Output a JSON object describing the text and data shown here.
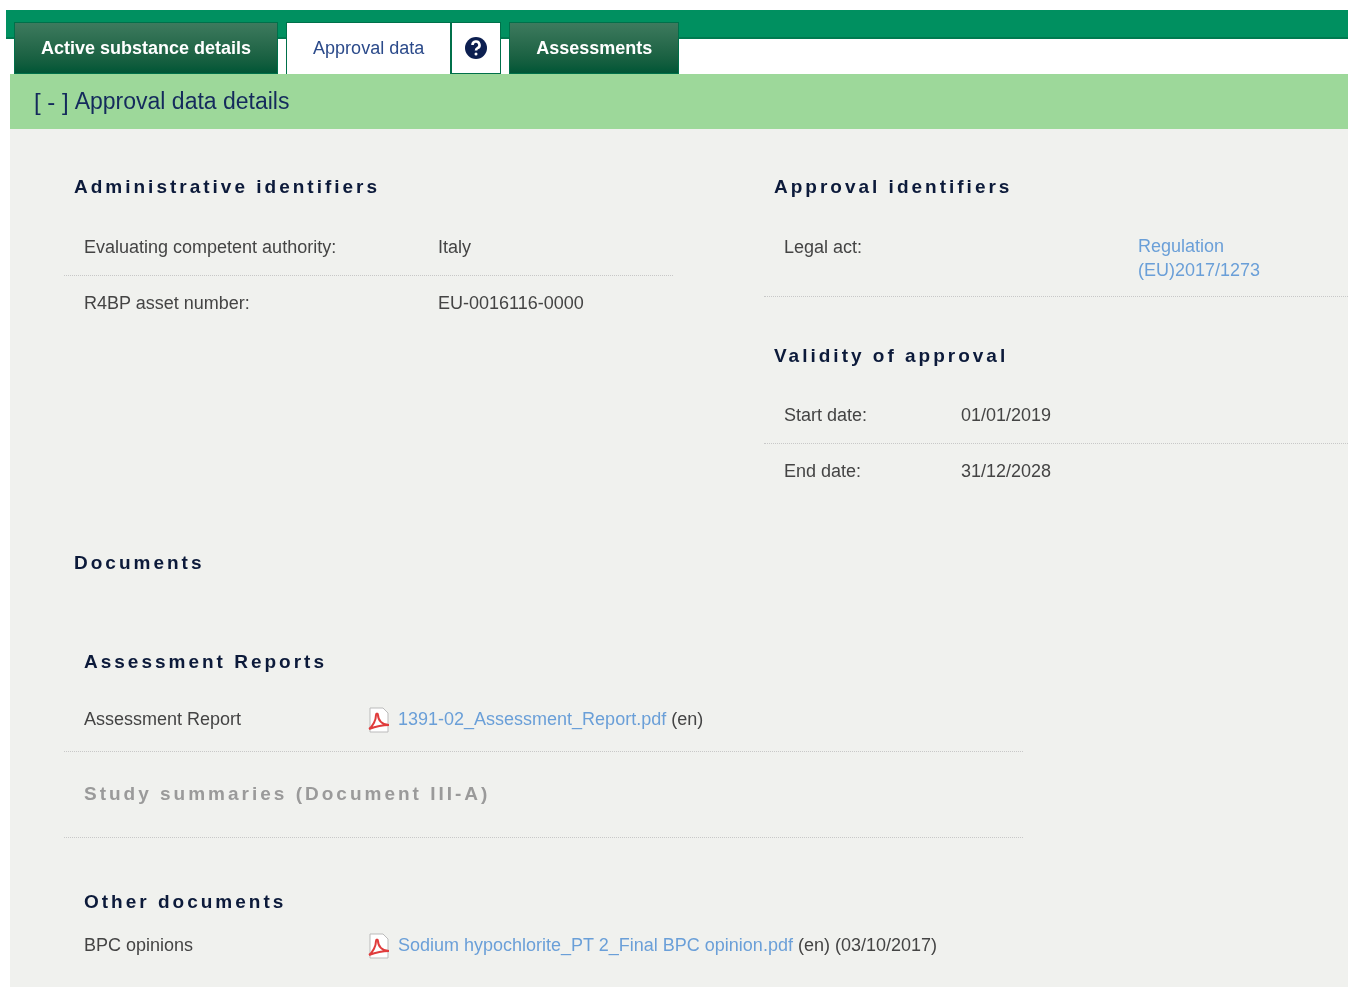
{
  "tabs": [
    {
      "label": "Active substance details",
      "selected": false,
      "has_help": false
    },
    {
      "label": "Approval data",
      "selected": true,
      "has_help": true
    },
    {
      "label": "Assessments",
      "selected": false,
      "has_help": false
    }
  ],
  "section": {
    "toggle": "[ - ]",
    "title": "Approval data details"
  },
  "administrative_identifiers": {
    "heading": "Administrative identifiers",
    "rows": [
      {
        "label": "Evaluating competent authority:",
        "value": "Italy"
      },
      {
        "label": "R4BP asset number:",
        "value": "EU-0016116-0000"
      }
    ]
  },
  "approval_identifiers": {
    "heading": "Approval identifiers",
    "rows": [
      {
        "label": "Legal act:",
        "value": "Regulation (EU)2017/1273",
        "kind": "link"
      }
    ]
  },
  "validity_of_approval": {
    "heading": "Validity of approval",
    "rows": [
      {
        "label": "Start date:",
        "value": "01/01/2019"
      },
      {
        "label": "End date:",
        "value": "31/12/2028"
      }
    ]
  },
  "documents": {
    "heading": "Documents",
    "groups": [
      {
        "heading": "Assessment Reports",
        "disabled": false,
        "rows": [
          {
            "label": "Assessment Report",
            "file": "1391-02_Assessment_Report.pdf",
            "details": "(en)"
          }
        ]
      },
      {
        "heading": "Study summaries (Document III-A)",
        "disabled": true
      },
      {
        "heading": "Other documents",
        "disabled": false,
        "rows": [
          {
            "label": "BPC opinions",
            "file": "Sodium hypochlorite_PT 2_Final BPC opinion.pdf",
            "details": "(en) (03/10/2017)"
          }
        ]
      }
    ]
  }
}
